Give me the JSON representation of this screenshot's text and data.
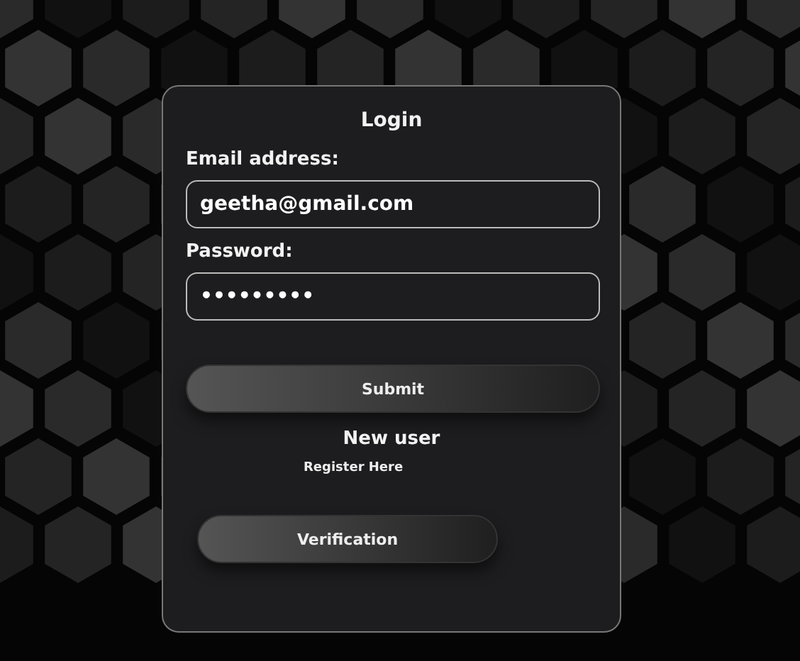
{
  "form": {
    "title": "Login",
    "fields": [
      {
        "label": "Email address:",
        "value": "geetha@gmail.com"
      },
      {
        "label": "Password:",
        "value": "•••••••••"
      }
    ],
    "submit_button": "Submit",
    "new_user_heading": "New user",
    "register_link": "Register Here",
    "verification_button": "Verification"
  }
}
